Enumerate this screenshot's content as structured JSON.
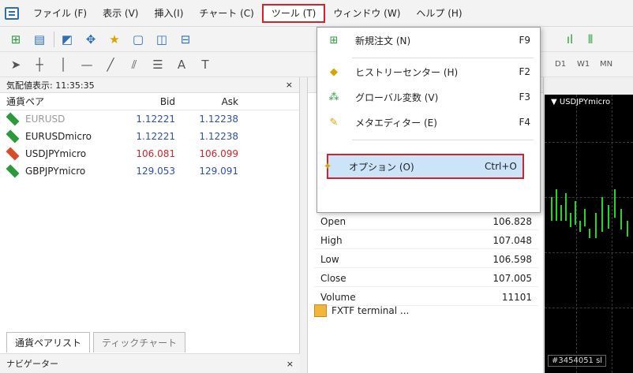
{
  "menubar": {
    "items": [
      "ファイル (F)",
      "表示 (V)",
      "挿入(I)",
      "チャート (C)",
      "ツール (T)",
      "ウィンドウ (W)",
      "ヘルプ (H)"
    ]
  },
  "toolbar2": {
    "font_icon_label": "A",
    "d1": "D1",
    "w1": "W1",
    "mn": "MN"
  },
  "market_watch": {
    "title": "気配値表示: 11:35:35",
    "close": "×",
    "headers": {
      "symbol": "通貨ペア",
      "bid": "Bid",
      "ask": "Ask"
    },
    "rows": [
      {
        "symbol": "EURUSD",
        "bid": "1.12221",
        "ask": "1.12238",
        "color": "#2c9a3a",
        "dim": true
      },
      {
        "symbol": "EURUSDmicro",
        "bid": "1.12221",
        "ask": "1.12238",
        "color": "#2c9a3a",
        "dim": false
      },
      {
        "symbol": "USDJPYmicro",
        "bid": "106.081",
        "ask": "106.099",
        "color": "#d94a2a",
        "dim": false
      },
      {
        "symbol": "GBPJPYmicro",
        "bid": "129.053",
        "ask": "129.091",
        "color": "#2c9a3a",
        "dim": false
      }
    ],
    "tabs": [
      "通貨ペアリスト",
      "ティックチャート"
    ],
    "bottom_title": "ナビゲーター",
    "bottom_close": "×"
  },
  "data_window": {
    "rows": [
      {
        "label": "Open",
        "value": "106.828"
      },
      {
        "label": "High",
        "value": "107.048"
      },
      {
        "label": "Low",
        "value": "106.598"
      },
      {
        "label": "Close",
        "value": "107.005"
      },
      {
        "label": "Volume",
        "value": "11101"
      }
    ],
    "footer": "FXTF terminal ..."
  },
  "chart": {
    "title": "▼ USDJPYmicro",
    "footer": "#3454051 sl"
  },
  "tools_menu": {
    "items": [
      {
        "label": "新規注文 (N)",
        "shortcut": "F9",
        "icon": "new-order-icon"
      },
      {
        "label": "ヒストリーセンター (H)",
        "shortcut": "F2",
        "icon": "history-center-icon"
      },
      {
        "label": "グローバル変数 (V)",
        "shortcut": "F3",
        "icon": "global-variables-icon"
      },
      {
        "label": "メタエディター (E)",
        "shortcut": "F4",
        "icon": "meta-editor-icon"
      },
      {
        "label": "オプション (O)",
        "shortcut": "Ctrl+O",
        "icon": "options-icon"
      }
    ]
  },
  "colors": {
    "highlight_border": "#d3222a",
    "menu_active_bg": "#cce4f7",
    "bid_blue": "#2c4fb0",
    "down_red": "#d3222a",
    "candle_green": "#26d426"
  }
}
